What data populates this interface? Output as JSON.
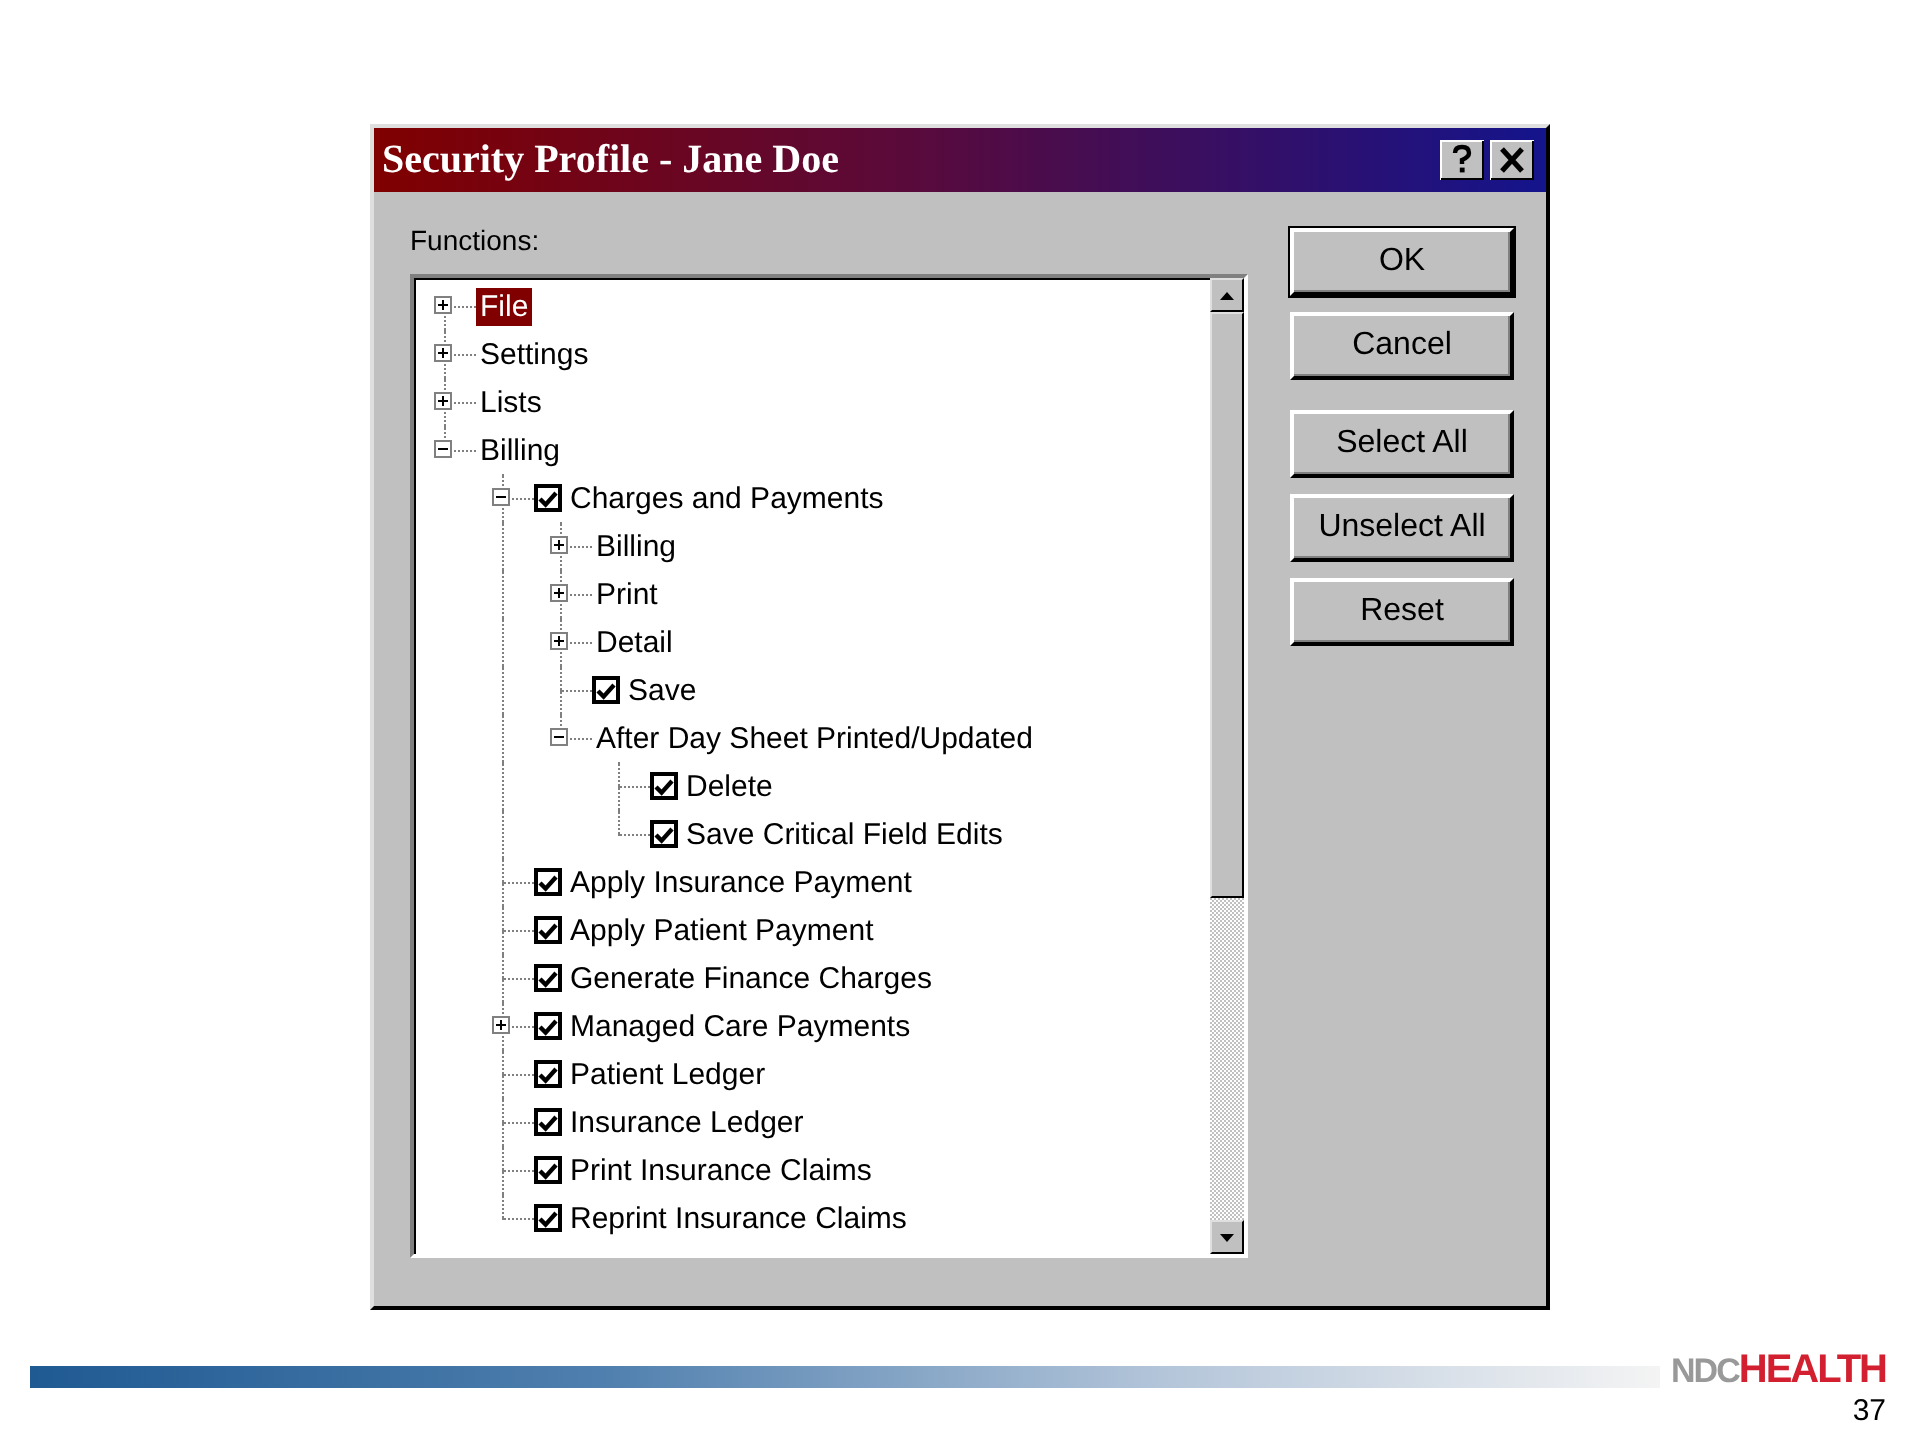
{
  "window": {
    "title": "Security Profile - Jane Doe"
  },
  "tree_label": "Functions:",
  "tree": [
    {
      "kind": "folder",
      "label": "File",
      "expanded": false,
      "selected": true
    },
    {
      "kind": "folder",
      "label": "Settings",
      "expanded": false,
      "selected": false
    },
    {
      "kind": "folder",
      "label": "Lists",
      "expanded": false,
      "selected": false
    },
    {
      "kind": "folder",
      "label": "Billing",
      "expanded": true,
      "selected": false,
      "children": [
        {
          "kind": "check",
          "label": "Charges and Payments",
          "checked": true,
          "expanded": true,
          "selected": false,
          "children": [
            {
              "kind": "folder",
              "label": "Billing",
              "expanded": false,
              "selected": false
            },
            {
              "kind": "folder",
              "label": "Print",
              "expanded": false,
              "selected": false
            },
            {
              "kind": "folder",
              "label": "Detail",
              "expanded": false,
              "selected": false
            },
            {
              "kind": "check",
              "label": "Save",
              "checked": true,
              "selected": false
            },
            {
              "kind": "folder",
              "label": "After Day Sheet Printed/Updated",
              "expanded": true,
              "selected": false,
              "children": [
                {
                  "kind": "check",
                  "label": "Delete",
                  "checked": true,
                  "selected": false
                },
                {
                  "kind": "check",
                  "label": "Save Critical Field Edits",
                  "checked": true,
                  "selected": false
                }
              ]
            }
          ]
        },
        {
          "kind": "check",
          "label": "Apply Insurance Payment",
          "checked": true,
          "selected": false
        },
        {
          "kind": "check",
          "label": "Apply Patient Payment",
          "checked": true,
          "selected": false
        },
        {
          "kind": "check",
          "label": "Generate Finance Charges",
          "checked": true,
          "selected": false
        },
        {
          "kind": "check",
          "label": "Managed Care Payments",
          "checked": true,
          "expanded": false,
          "selected": false
        },
        {
          "kind": "check",
          "label": "Patient Ledger",
          "checked": true,
          "selected": false
        },
        {
          "kind": "check",
          "label": "Insurance Ledger",
          "checked": true,
          "selected": false
        },
        {
          "kind": "check",
          "label": "Print Insurance Claims",
          "checked": true,
          "selected": false
        },
        {
          "kind": "check",
          "label": "Reprint Insurance Claims",
          "checked": true,
          "selected": false
        }
      ]
    }
  ],
  "buttons": [
    {
      "label": "OK",
      "default": true
    },
    {
      "label": "Cancel",
      "default": false
    },
    {
      "label": "Select All",
      "default": false
    },
    {
      "label": "Unselect All",
      "default": false
    },
    {
      "label": "Reset",
      "default": false
    }
  ],
  "slide": {
    "logo_part_1": "NDC",
    "logo_part_2": "HEALTH",
    "page_number": "37"
  }
}
